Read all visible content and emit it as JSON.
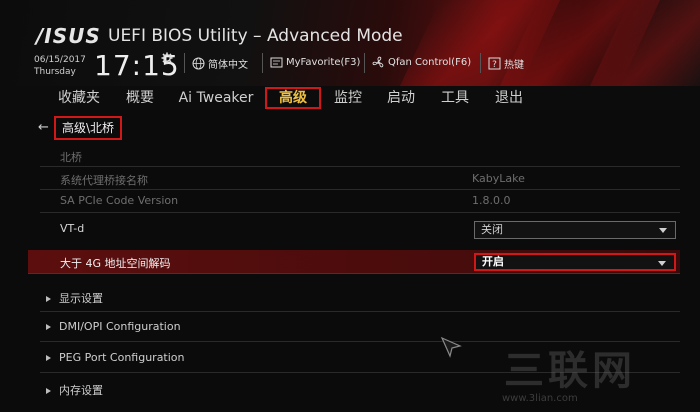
{
  "header": {
    "logo": "/ISUS",
    "title": "UEFI BIOS Utility – Advanced Mode",
    "date": "06/15/2017",
    "weekday": "Thursday",
    "time": "17:15",
    "tools": {
      "language": "简体中文",
      "myfavorite": "MyFavorite(F3)",
      "qfan": "Qfan Control(F6)",
      "hotkey": "热键"
    }
  },
  "tabs": [
    {
      "label": "收藏夹"
    },
    {
      "label": "概要"
    },
    {
      "label": "Ai Tweaker"
    },
    {
      "label": "高级"
    },
    {
      "label": "监控"
    },
    {
      "label": "启动"
    },
    {
      "label": "工具"
    },
    {
      "label": "退出"
    }
  ],
  "breadcrumb": "高级\\北桥",
  "section": "北桥",
  "info_rows": [
    {
      "label": "系统代理桥接名称",
      "value": "KabyLake"
    },
    {
      "label": "SA PCIe Code Version",
      "value": "1.8.0.0"
    }
  ],
  "settings": [
    {
      "label": "VT-d",
      "value": "关闭"
    },
    {
      "label": "大于 4G 地址空间解码",
      "value": "开启"
    }
  ],
  "submenus": [
    {
      "label": "显示设置"
    },
    {
      "label": "DMI/OPI Configuration"
    },
    {
      "label": "PEG Port Configuration"
    },
    {
      "label": "内存设置"
    }
  ],
  "watermark": "三联网",
  "watermark_url": "www.3lian.com",
  "colors": {
    "accent_red": "#d01818",
    "active_tab_text": "#f0c040",
    "highlight_row": "#5c0e0e"
  }
}
